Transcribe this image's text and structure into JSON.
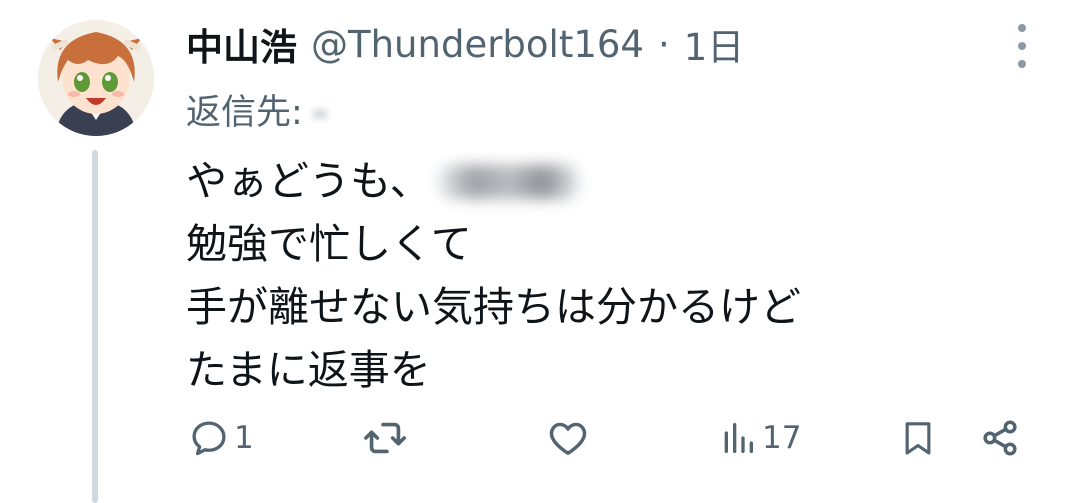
{
  "tweet": {
    "display_name": "中山浩",
    "handle": "@Thunderbolt164",
    "separator": "·",
    "time": "1日",
    "reply_to_label": "返信先:",
    "lines": [
      "やぁどうも、",
      "勉強で忙しくて",
      "手が離せない気持ちは分かるけど",
      "たまに返事を"
    ]
  },
  "actions": {
    "reply_count": "1",
    "views_count": "17"
  },
  "icons": {
    "more": "more-vertical-icon",
    "reply": "reply-icon",
    "repost": "repost-icon",
    "like": "heart-icon",
    "views": "views-icon",
    "bookmark": "bookmark-icon",
    "share": "share-icon"
  },
  "colors": {
    "text": "#0f1419",
    "secondary": "#536471",
    "thread_line": "#cfd9de"
  }
}
